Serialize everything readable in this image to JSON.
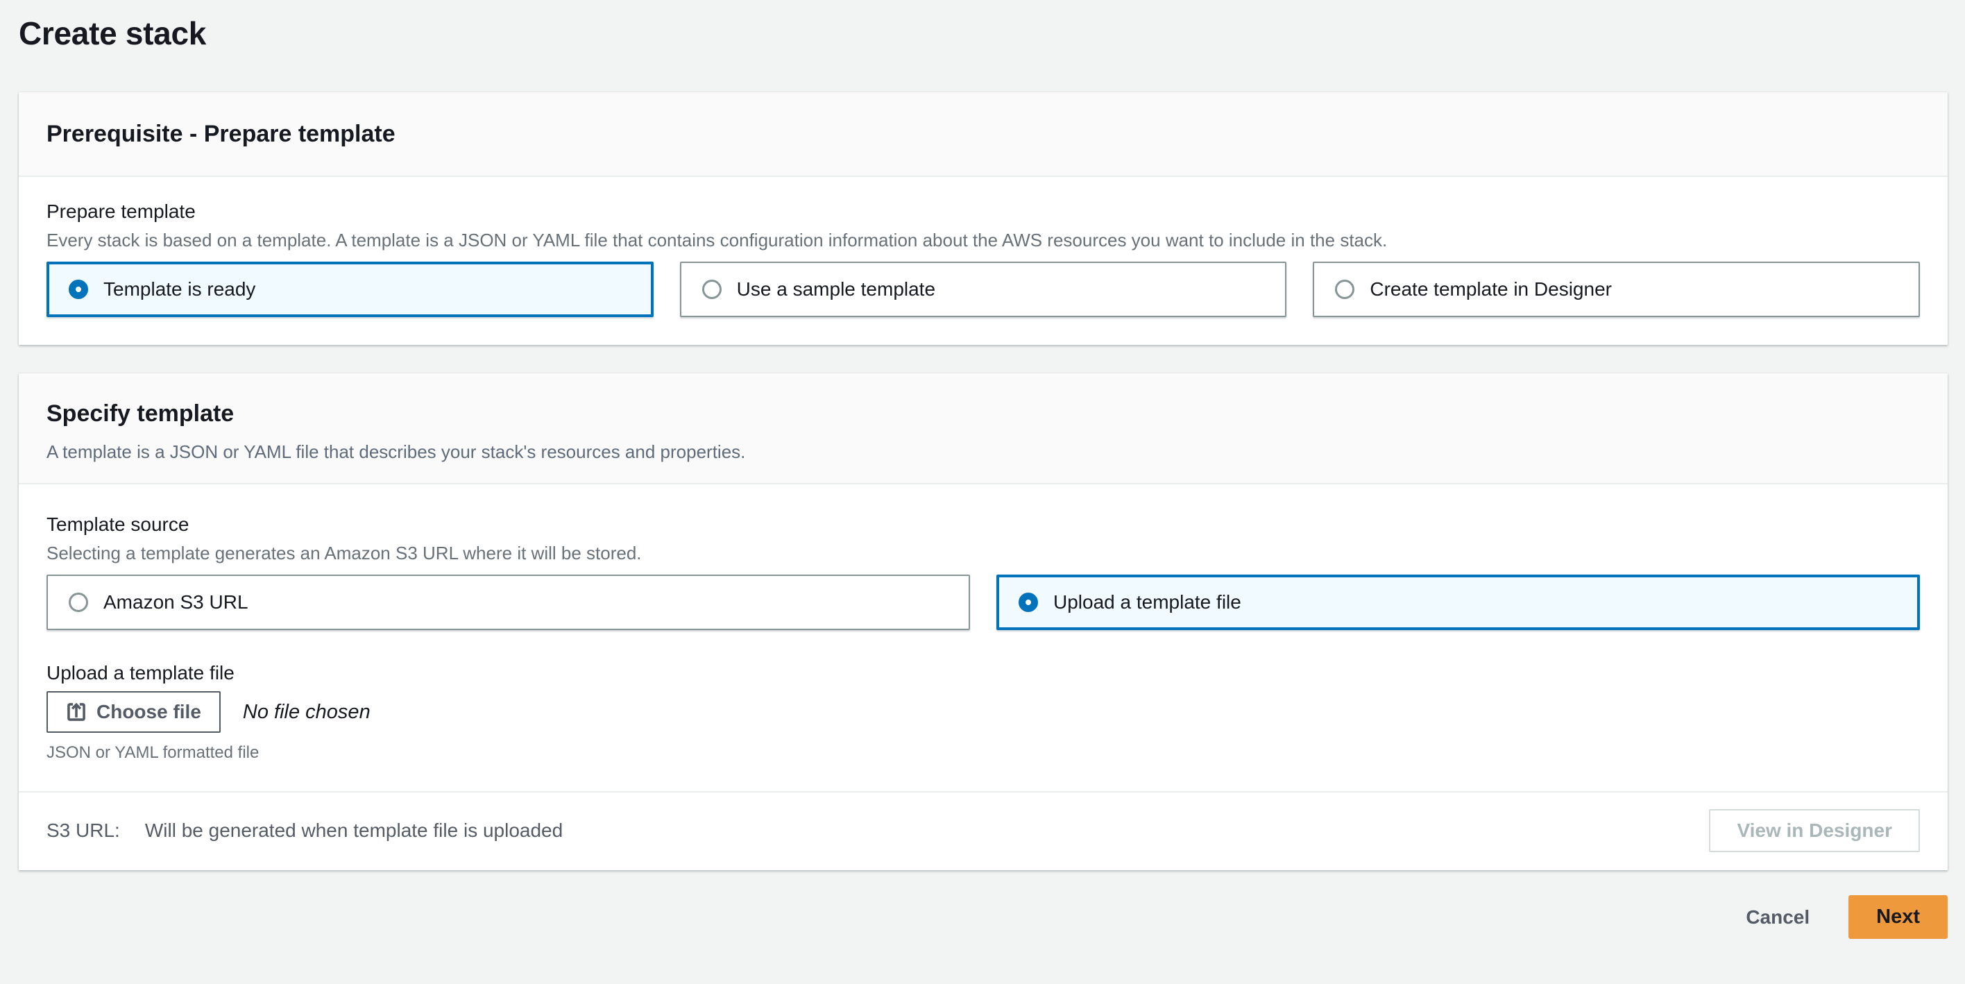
{
  "page": {
    "title": "Create stack"
  },
  "colors": {
    "page_bg": "#f2f3f3",
    "accent_orange": "#ee993c",
    "selected_blue": "#0073bb",
    "selected_tile_bg": "#f1faff",
    "text_dark": "#16191f",
    "text_secondary": "#545b64",
    "text_hint": "#687078",
    "disabled_text": "#aab7b8"
  },
  "prerequisite_card": {
    "title": "Prerequisite - Prepare template",
    "prepare_template": {
      "label": "Prepare template",
      "description": "Every stack is based on a template. A template is a JSON or YAML file that contains configuration information about the AWS resources you want to include in the stack.",
      "options": [
        {
          "label": "Template is ready",
          "selected": true
        },
        {
          "label": "Use a sample template",
          "selected": false
        },
        {
          "label": "Create template in Designer",
          "selected": false
        }
      ]
    }
  },
  "specify_card": {
    "title": "Specify template",
    "description": "A template is a JSON or YAML file that describes your stack's resources and properties.",
    "template_source": {
      "label": "Template source",
      "description": "Selecting a template generates an Amazon S3 URL where it will be stored.",
      "options": [
        {
          "label": "Amazon S3 URL",
          "selected": false
        },
        {
          "label": "Upload a template file",
          "selected": true
        }
      ]
    },
    "upload_field": {
      "label": "Upload a template file",
      "choose_file_button": "Choose file",
      "file_status": "No file chosen",
      "constraint": "JSON or YAML formatted file"
    },
    "s3_url_row": {
      "label": "S3 URL:",
      "value": "Will be generated when template file is uploaded"
    },
    "view_in_designer_button": "View in Designer"
  },
  "footer_actions": {
    "cancel": "Cancel",
    "next": "Next"
  }
}
